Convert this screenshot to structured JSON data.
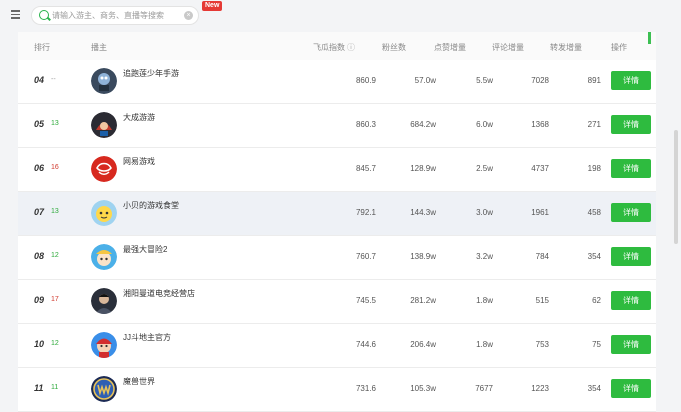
{
  "search": {
    "placeholder": "请输入游主、商务、直播等搜索",
    "new_badge": "New"
  },
  "table": {
    "headers": {
      "rank": "排行",
      "streamer": "播主",
      "index": "飞瓜指数",
      "fans": "粉丝数",
      "likes_inc": "点赞增量",
      "comments_inc": "评论增量",
      "shares_inc": "转发增量",
      "action": "操作"
    },
    "rows": [
      {
        "rank": "04",
        "delta": "--",
        "trend": "flat",
        "name": "追跑莲少年手游",
        "index": "860.9",
        "fans": "57.0w",
        "likes": "5.5w",
        "comments": "7028",
        "shares": "891",
        "btn": "详情",
        "avatar": "dark-robot"
      },
      {
        "rank": "05",
        "delta": "13",
        "trend": "up",
        "name": "大成游游",
        "index": "860.3",
        "fans": "684.2w",
        "likes": "6.0w",
        "comments": "1368",
        "shares": "271",
        "btn": "详情",
        "avatar": "dark-hero"
      },
      {
        "rank": "06",
        "delta": "16",
        "trend": "down",
        "name": "网易游戏",
        "index": "845.7",
        "fans": "128.9w",
        "likes": "2.5w",
        "comments": "4737",
        "shares": "198",
        "btn": "详情",
        "avatar": "red-logo"
      },
      {
        "rank": "07",
        "delta": "13",
        "trend": "up",
        "name": "小贝的游戏食堂",
        "index": "792.1",
        "fans": "144.3w",
        "likes": "3.0w",
        "comments": "1961",
        "shares": "458",
        "btn": "详情",
        "avatar": "yellow-cartoon"
      },
      {
        "rank": "08",
        "delta": "12",
        "trend": "up",
        "name": "最强大冒险2",
        "index": "760.7",
        "fans": "138.9w",
        "likes": "3.2w",
        "comments": "784",
        "shares": "354",
        "btn": "详情",
        "avatar": "blue-cartoon"
      },
      {
        "rank": "09",
        "delta": "17",
        "trend": "down",
        "name": "湘阳曼道电竞经营店",
        "index": "745.5",
        "fans": "281.2w",
        "likes": "1.8w",
        "comments": "515",
        "shares": "62",
        "btn": "详情",
        "avatar": "dark-person"
      },
      {
        "rank": "10",
        "delta": "12",
        "trend": "up",
        "name": "JJ斗地主官方",
        "index": "744.6",
        "fans": "206.4w",
        "likes": "1.8w",
        "comments": "753",
        "shares": "75",
        "btn": "详情",
        "avatar": "red-cartoon"
      },
      {
        "rank": "11",
        "delta": "11",
        "trend": "up",
        "name": "魔兽世界",
        "index": "731.6",
        "fans": "105.3w",
        "likes": "7677",
        "comments": "1223",
        "shares": "354",
        "btn": "详情",
        "avatar": "wow-logo"
      }
    ]
  },
  "colors": {
    "accent": "#2ebb3f",
    "up": "#2eaa3c",
    "down": "#d13a2e",
    "highlight_row": "#eef1f6"
  }
}
